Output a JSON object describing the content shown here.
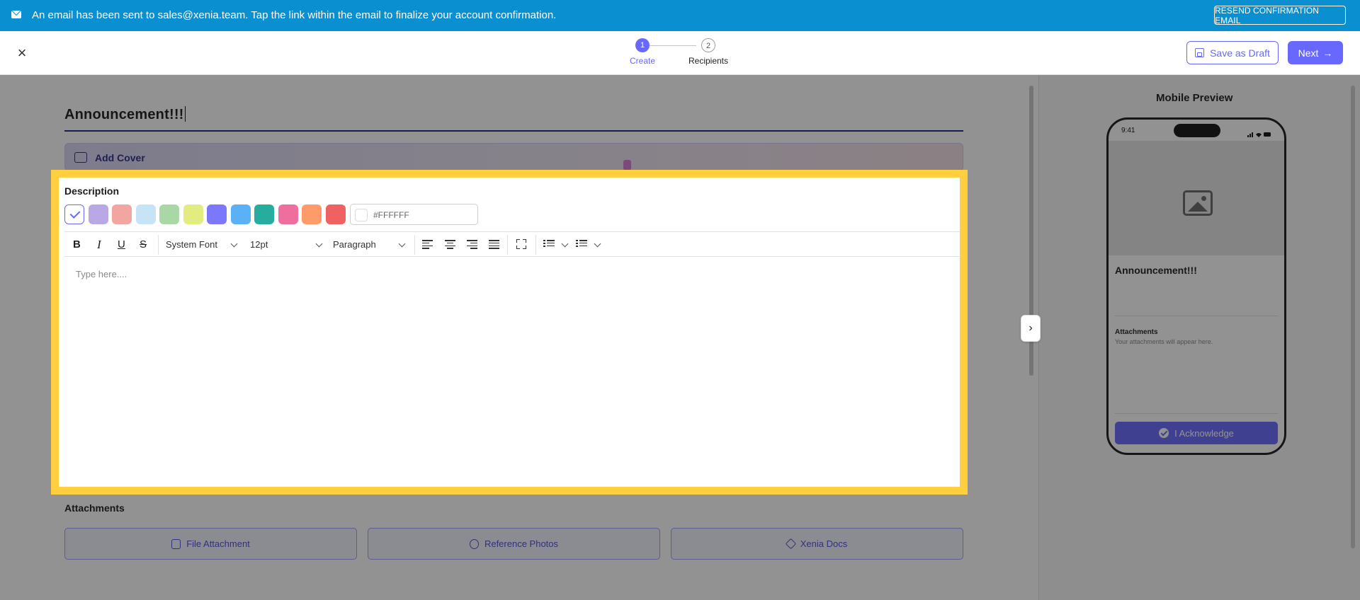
{
  "banner": {
    "message": "An email has been sent to sales@xenia.team. Tap the link within the email to finalize your account confirmation.",
    "resend_label": "RESEND CONFIRMATION EMAIL",
    "icon": "mail-icon"
  },
  "header": {
    "steps": [
      {
        "number": "1",
        "label": "Create",
        "active": true
      },
      {
        "number": "2",
        "label": "Recipients",
        "active": false
      }
    ],
    "save_draft_label": "Save as Draft",
    "next_label": "Next",
    "next_arrow": "→",
    "close_glyph": "×"
  },
  "form": {
    "title_value": "Announcement!!!",
    "add_cover_label": "Add Cover",
    "description_label": "Description",
    "colors": [
      "#ffffff",
      "#b9a8e6",
      "#f2a5a1",
      "#c7e4f7",
      "#a8d9a5",
      "#e3ec80",
      "#7b78fb",
      "#5bb1f5",
      "#26ad9d",
      "#ee6f9e",
      "#ff9a6a",
      "#f06262"
    ],
    "hex_value": "#FFFFFF",
    "toolbar": {
      "bold": "B",
      "italic": "I",
      "underline": "U",
      "strike": "S",
      "font_family": "System Font",
      "font_size": "12pt",
      "block_format": "Paragraph"
    },
    "editor_placeholder": "Type here...."
  },
  "attachments": {
    "label": "Attachments",
    "buttons": [
      {
        "label": "File Attachment",
        "icon": "file-icon"
      },
      {
        "label": "Reference Photos",
        "icon": "photo-icon"
      },
      {
        "label": "Xenia Docs",
        "icon": "layers-icon"
      }
    ]
  },
  "preview": {
    "title": "Mobile Preview",
    "phone_time": "9:41",
    "announcement_title": "Announcement!!!",
    "attachments_heading": "Attachments",
    "attachments_sub": "Your attachments will appear here.",
    "acknowledge_label": "I Acknowledge"
  },
  "colors": {
    "accent": "#6868fe",
    "banner": "#0a8fd1",
    "highlight": "#ffcf3f"
  }
}
